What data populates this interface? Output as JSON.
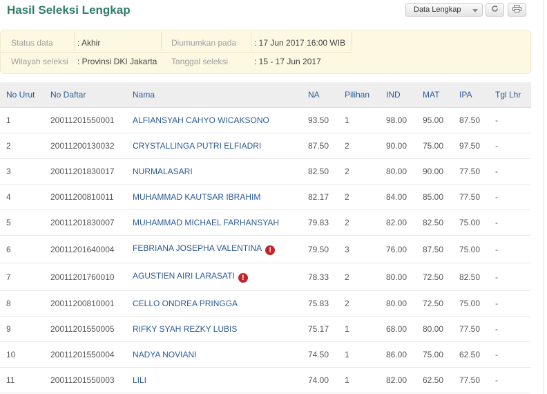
{
  "header": {
    "title": "Hasil Seleksi Lengkap",
    "dropdown_label": "Data Lengkap",
    "refresh_icon": "refresh-icon",
    "print_icon": "print-icon"
  },
  "info": {
    "status_label": "Status data",
    "status_value": ": Akhir",
    "wilayah_label": "Wilayah seleksi",
    "wilayah_value": ": Provinsi DKI Jakarta",
    "diumumkan_label": "Diumumkan pada",
    "diumumkan_value": ": 17 Jun 2017 16:00 WIB",
    "tanggal_label": "Tanggal seleksi",
    "tanggal_value": ": 15 - 17 Jun 2017"
  },
  "table": {
    "headers": [
      "No Urut",
      "No Daftar",
      "Nama",
      "NA",
      "Pilihan",
      "IND",
      "MAT",
      "IPA",
      "Tgl Lhr"
    ],
    "rows": [
      {
        "no": "1",
        "daftar": "20011201550001",
        "nama": "ALFIANSYAH CAHYO WICAKSONO",
        "na": "93.50",
        "pilihan": "1",
        "ind": "98.00",
        "mat": "95.00",
        "ipa": "87.50",
        "tgl": "-",
        "warn": false
      },
      {
        "no": "2",
        "daftar": "20011200130032",
        "nama": "CRYSTALLINGA PUTRI ELFIADRI",
        "na": "87.50",
        "pilihan": "2",
        "ind": "90.00",
        "mat": "75.00",
        "ipa": "97.50",
        "tgl": "-",
        "warn": false
      },
      {
        "no": "3",
        "daftar": "20011201830017",
        "nama": "NURMALASARI",
        "na": "82.50",
        "pilihan": "2",
        "ind": "80.00",
        "mat": "90.00",
        "ipa": "77.50",
        "tgl": "-",
        "warn": false
      },
      {
        "no": "4",
        "daftar": "20011200810011",
        "nama": "MUHAMMAD KAUTSAR IBRAHIM",
        "na": "82.17",
        "pilihan": "2",
        "ind": "84.00",
        "mat": "85.00",
        "ipa": "77.50",
        "tgl": "-",
        "warn": false
      },
      {
        "no": "5",
        "daftar": "20011201830007",
        "nama": "MUHAMMAD MICHAEL FARHANSYAH",
        "na": "79.83",
        "pilihan": "2",
        "ind": "82.00",
        "mat": "82.50",
        "ipa": "75.00",
        "tgl": "-",
        "warn": false
      },
      {
        "no": "6",
        "daftar": "20011201640004",
        "nama": "FEBRIANA JOSEPHA VALENTINA",
        "na": "79.50",
        "pilihan": "3",
        "ind": "76.00",
        "mat": "87.50",
        "ipa": "75.00",
        "tgl": "-",
        "warn": true
      },
      {
        "no": "7",
        "daftar": "20011201760010",
        "nama": "AGUSTIEN AIRI LARASATI",
        "na": "78.33",
        "pilihan": "2",
        "ind": "80.00",
        "mat": "72.50",
        "ipa": "82.50",
        "tgl": "-",
        "warn": true
      },
      {
        "no": "8",
        "daftar": "20011200810001",
        "nama": "CELLO ONDREA PRINGGA",
        "na": "75.83",
        "pilihan": "2",
        "ind": "80.00",
        "mat": "72.50",
        "ipa": "75.00",
        "tgl": "-",
        "warn": false
      },
      {
        "no": "9",
        "daftar": "20011201550005",
        "nama": "RIFKY SYAH REZKY LUBIS",
        "na": "75.17",
        "pilihan": "1",
        "ind": "68.00",
        "mat": "80.00",
        "ipa": "77.50",
        "tgl": "-",
        "warn": false
      },
      {
        "no": "10",
        "daftar": "20011201550004",
        "nama": "NADYA NOVIANI",
        "na": "74.50",
        "pilihan": "1",
        "ind": "86.00",
        "mat": "75.00",
        "ipa": "62.50",
        "tgl": "-",
        "warn": false
      },
      {
        "no": "11",
        "daftar": "20011201550003",
        "nama": "LILI",
        "na": "74.00",
        "pilihan": "1",
        "ind": "82.00",
        "mat": "62.50",
        "ipa": "77.50",
        "tgl": "-",
        "warn": false
      }
    ]
  }
}
